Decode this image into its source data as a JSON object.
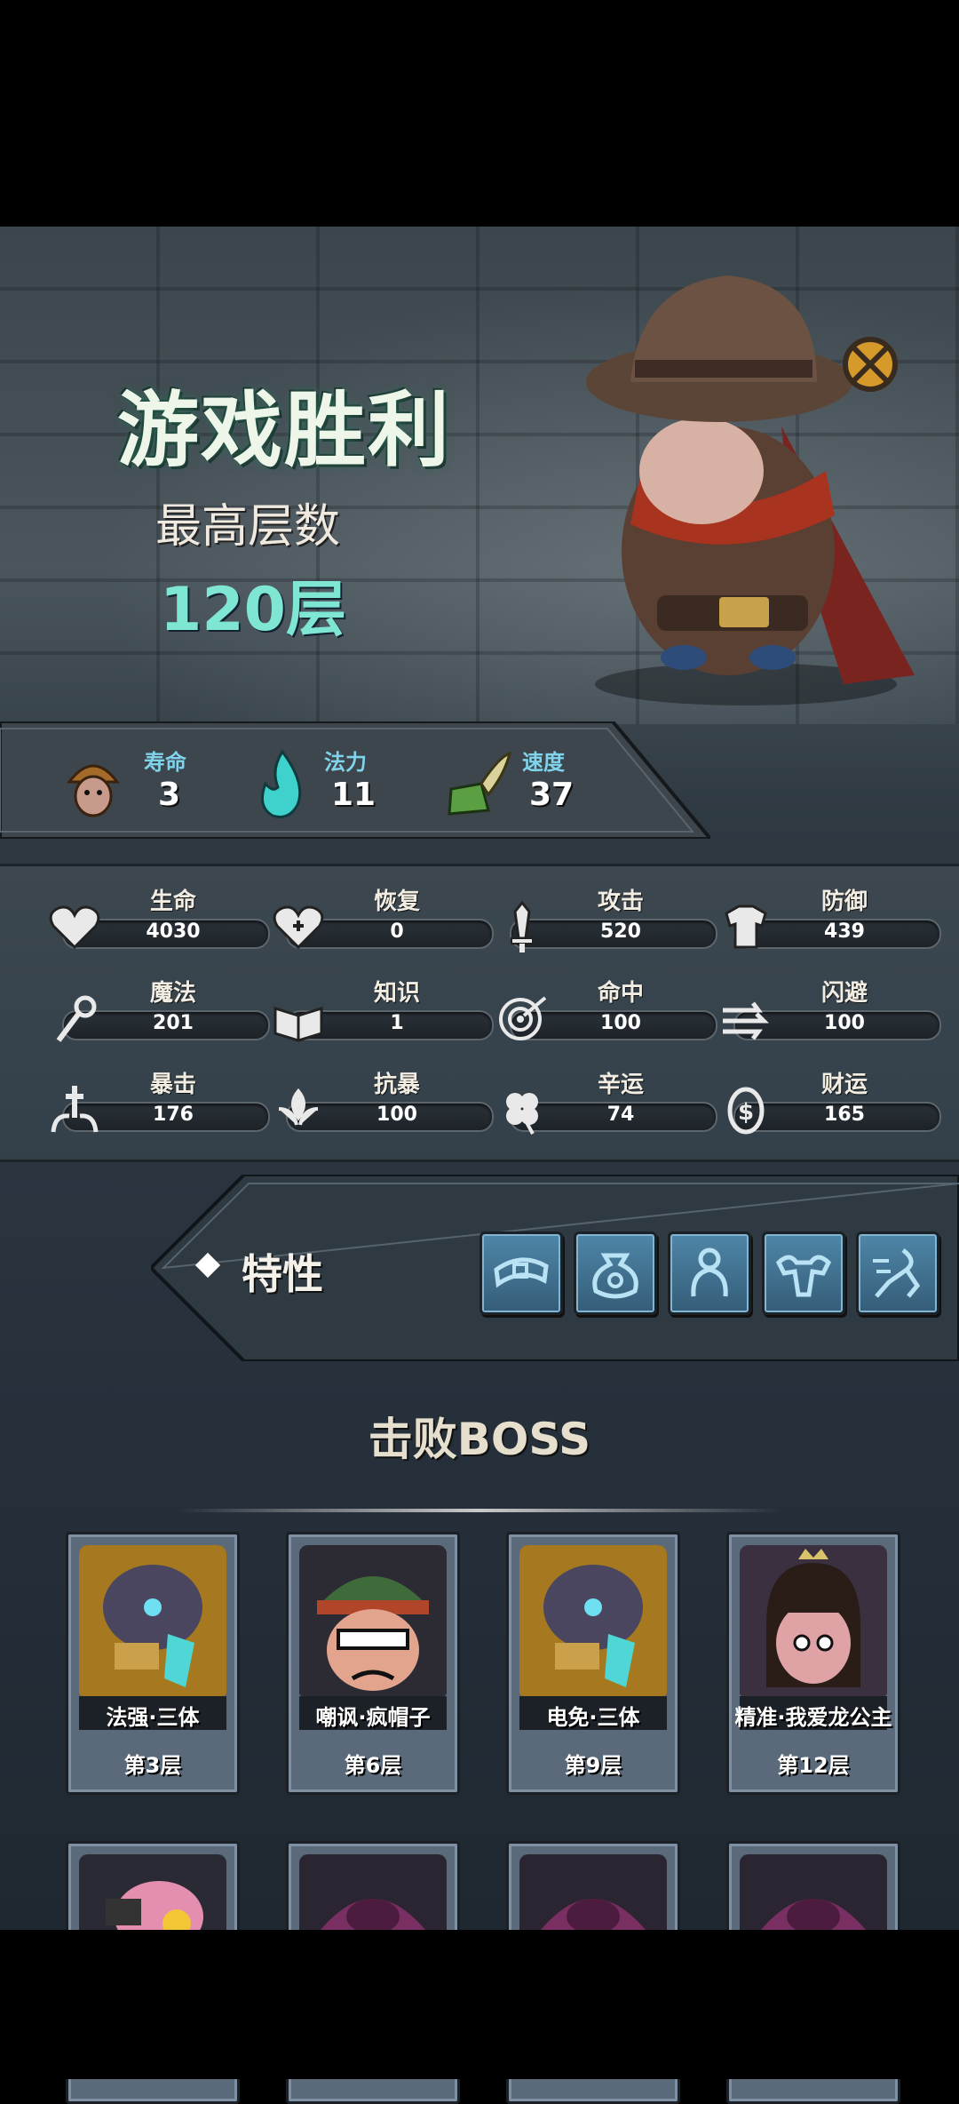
{
  "result": {
    "title": "游戏胜利",
    "floor_label": "最高层数",
    "floor_value": "120层"
  },
  "banner": [
    {
      "label": "寿命",
      "value": "3",
      "icon": "mushroom-hero-icon"
    },
    {
      "label": "法力",
      "value": "11",
      "icon": "blue-flame-icon"
    },
    {
      "label": "速度",
      "value": "37",
      "icon": "winged-boot-icon"
    }
  ],
  "stats": [
    {
      "label": "生命",
      "value": "4030",
      "icon": "heart-icon"
    },
    {
      "label": "恢复",
      "value": "0",
      "icon": "heart-plus-icon"
    },
    {
      "label": "攻击",
      "value": "520",
      "icon": "sword-icon"
    },
    {
      "label": "防御",
      "value": "439",
      "icon": "armor-icon"
    },
    {
      "label": "魔法",
      "value": "201",
      "icon": "staff-icon"
    },
    {
      "label": "知识",
      "value": "1",
      "icon": "book-icon"
    },
    {
      "label": "命中",
      "value": "100",
      "icon": "target-icon"
    },
    {
      "label": "闪避",
      "value": "100",
      "icon": "dodge-arrows-icon"
    },
    {
      "label": "暴击",
      "value": "176",
      "icon": "crit-burst-icon"
    },
    {
      "label": "抗暴",
      "value": "100",
      "icon": "crit-resist-icon"
    },
    {
      "label": "辛运",
      "value": "74",
      "icon": "clover-icon"
    },
    {
      "label": "财运",
      "value": "165",
      "icon": "coin-icon"
    }
  ],
  "traits": {
    "label": "特性",
    "items": [
      "belt-trait-icon",
      "moneybag-trait-icon",
      "brute-trait-icon",
      "muscle-trait-icon",
      "dash-trait-icon"
    ]
  },
  "bosses": {
    "title": "击败BOSS",
    "items": [
      {
        "name": "法强·三体",
        "floor": "第3层"
      },
      {
        "name": "嘲讽·疯帽子",
        "floor": "第6层"
      },
      {
        "name": "电免·三体",
        "floor": "第9层"
      },
      {
        "name": "精准·我爱龙公主",
        "floor": "第12层"
      }
    ]
  },
  "colors": {
    "accent_teal": "#7fe6d4",
    "stat_label_blue": "#7fd3ea",
    "trait_slot": "#4f86a8"
  }
}
